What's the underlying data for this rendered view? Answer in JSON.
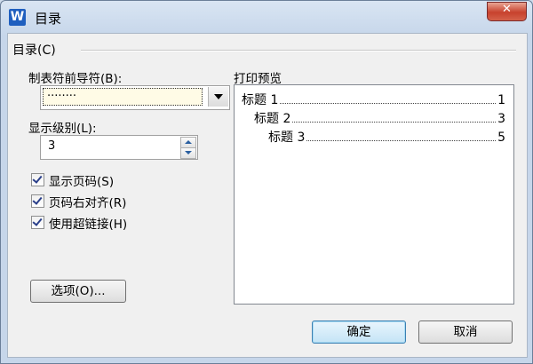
{
  "window": {
    "title": "目录",
    "app_icon": "W",
    "close_glyph": "✕"
  },
  "group": {
    "label": "目录(C)"
  },
  "leader": {
    "label": "制表符前导符(B):",
    "value": "········"
  },
  "level": {
    "label": "显示级别(L):",
    "value": "3"
  },
  "checkboxes": [
    {
      "label": "显示页码(S)",
      "checked": true
    },
    {
      "label": "页码右对齐(R)",
      "checked": true
    },
    {
      "label": "使用超链接(H)",
      "checked": true
    }
  ],
  "options_button": "选项(O)...",
  "preview": {
    "label": "打印预览",
    "entries": [
      {
        "title": "标题 1",
        "page": "1"
      },
      {
        "title": "标题 2",
        "page": "3"
      },
      {
        "title": "标题 3",
        "page": "5"
      }
    ]
  },
  "buttons": {
    "ok": "确定",
    "cancel": "取消"
  },
  "colors": {
    "accent": "#3c7fb1",
    "close": "#c7422d",
    "app_icon": "#1f5fbf"
  }
}
